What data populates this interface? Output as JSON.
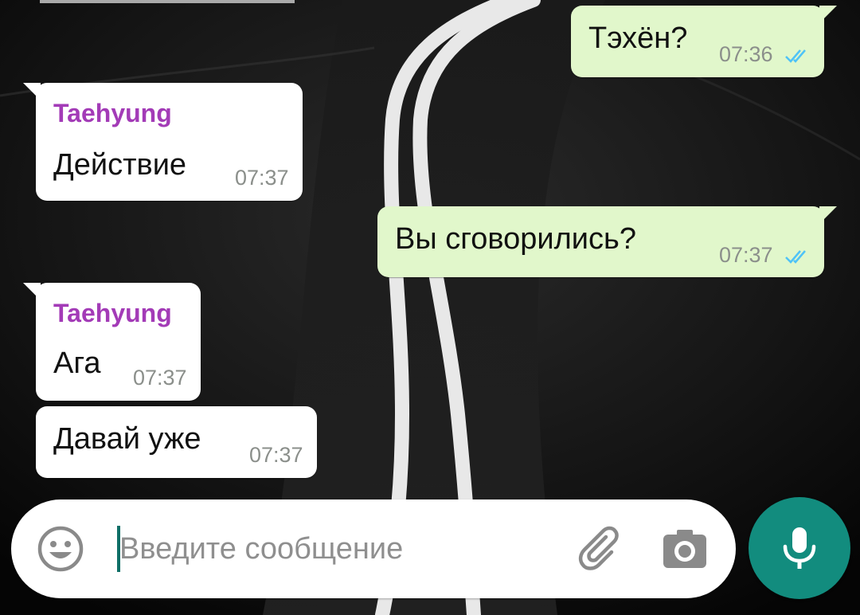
{
  "colors": {
    "incoming_bubble": "#ffffff",
    "outgoing_bubble": "#e1f7cb",
    "sender_name": "#a33bb7",
    "timestamp": "#8b8f8b",
    "read_ticks": "#4fc3f7",
    "mic_button": "#128c7e",
    "cursor": "#0f6f67"
  },
  "messages": [
    {
      "direction": "out",
      "text": "Тэхён?",
      "time": "07:36",
      "status": "read"
    },
    {
      "direction": "in",
      "sender": "Taehyung",
      "text": "Действие",
      "time": "07:37"
    },
    {
      "direction": "out",
      "text": "Вы сговорились?",
      "time": "07:37",
      "status": "read"
    },
    {
      "direction": "in",
      "sender": "Taehyung",
      "text": "Ага",
      "time": "07:37"
    },
    {
      "direction": "in",
      "text": "Давай уже",
      "time": "07:37"
    }
  ],
  "composer": {
    "placeholder": "Введите сообщение",
    "value": "",
    "icons": {
      "emoji": "smiley-face-icon",
      "attach": "paperclip-icon",
      "camera": "camera-icon",
      "mic": "microphone-icon"
    }
  }
}
